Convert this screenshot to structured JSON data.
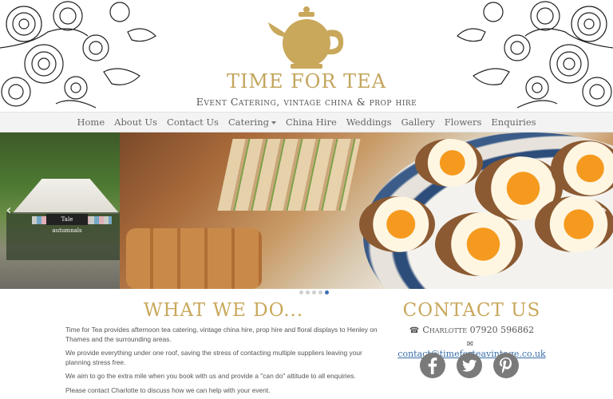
{
  "header": {
    "title": "TIME FOR TEA",
    "subtitle": "Event Catering, vintage china & prop hire"
  },
  "nav": {
    "items": [
      {
        "label": "Home"
      },
      {
        "label": "About Us"
      },
      {
        "label": "Contact Us"
      },
      {
        "label": "Catering",
        "dropdown": true
      },
      {
        "label": "China Hire"
      },
      {
        "label": "Weddings"
      },
      {
        "label": "Gallery"
      },
      {
        "label": "Flowers"
      },
      {
        "label": "Enquiries"
      }
    ]
  },
  "slider": {
    "left_sign": "Tale autumnals",
    "dot_count": 5,
    "active_dot": 5
  },
  "what": {
    "title": "WHAT WE DO...",
    "paragraphs": [
      "Time for Tea provides afternoon tea catering, vintage china hire, prop hire and floral displays to Henley on Thames and the surrounding areas.",
      "We provide everything under one roof, saving the stress of contacting multiple suppliers leaving your planning stress free.",
      "We aim to go the extra mile when you book with us and provide a \"can do\" attitude to all enquiries.",
      "Please contact Charlotte to discuss how we can help with your event."
    ]
  },
  "contact": {
    "title": "CONTACT US",
    "phone_label": "Charlotte 07920 596862",
    "email": "contact@timeforteavintage.co.uk"
  },
  "colors": {
    "gold": "#c9a85c",
    "link": "#3a6ea8",
    "social_grey": "#7a7a7a"
  },
  "icons": [
    "phone-icon",
    "envelope-icon",
    "facebook-icon",
    "twitter-icon",
    "pinterest-icon",
    "teapot-logo"
  ]
}
